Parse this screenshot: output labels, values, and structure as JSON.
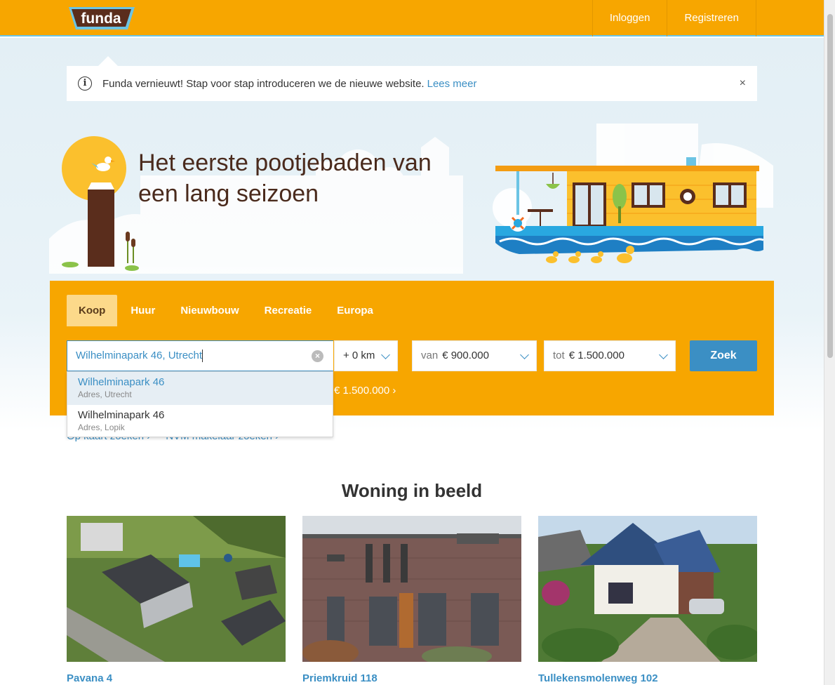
{
  "brand": {
    "logo_text": "funda",
    "orange": "#f7a600",
    "blue": "#3b8fc4",
    "brown": "#4a2a1c"
  },
  "header": {
    "nav": [
      {
        "label": "Inloggen"
      },
      {
        "label": "Registreren"
      }
    ]
  },
  "notice": {
    "text": "Funda vernieuwt! Stap voor stap introduceren we de nieuwe website.",
    "link": "Lees meer",
    "icon": "info-icon",
    "close_icon": "close-icon",
    "close_glyph": "×"
  },
  "hero": {
    "title": "Het eerste pootjebaden van een lang seizoen"
  },
  "search": {
    "tabs": [
      {
        "label": "Koop",
        "active": true
      },
      {
        "label": "Huur"
      },
      {
        "label": "Nieuwbouw"
      },
      {
        "label": "Recreatie"
      },
      {
        "label": "Europa"
      }
    ],
    "query": "Wilhelminapark 46, Utrecht",
    "radius": "+ 0 km",
    "price_from_prefix": "van",
    "price_from": "€ 900.000",
    "price_to_prefix": "tot",
    "price_to": "€ 1.500.000",
    "button": "Zoek",
    "last_search": "€ 1.500.000  ›",
    "suggestions": [
      {
        "title": "Wilhelminapark 46",
        "subtitle": "Adres, Utrecht",
        "highlighted": true
      },
      {
        "title": "Wilhelminapark 46",
        "subtitle": "Adres, Lopik"
      }
    ]
  },
  "sublinks": [
    "Op kaart zoeken  ›",
    "NVM makelaar zoeken  ›"
  ],
  "featured": {
    "title": "Woning in beeld",
    "items": [
      {
        "caption": "Pavana 4"
      },
      {
        "caption": "Priemkruid 118"
      },
      {
        "caption": "Tullekensmolenweg 102"
      }
    ]
  }
}
